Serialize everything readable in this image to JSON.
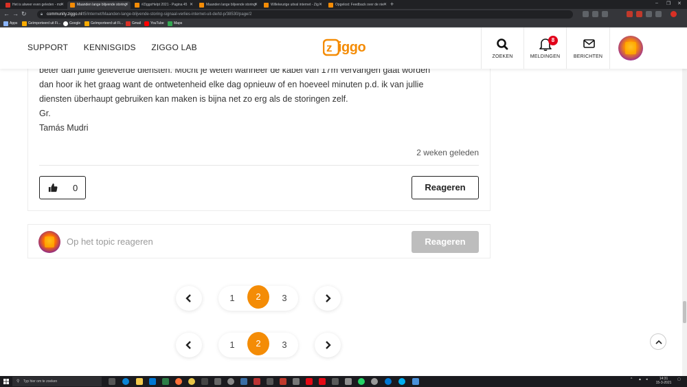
{
  "browser": {
    "tabs": [
      {
        "title": "Het is alweer even geleden - mo",
        "icon": "gmail-icon",
        "active": false
      },
      {
        "title": "Maanden lange blijvende storing",
        "icon": "ziggo-icon",
        "active": true
      },
      {
        "title": "#ZiggoHelpt 2021 - Pagina 45",
        "icon": "ziggo-icon",
        "active": false
      },
      {
        "title": "Maanden lange blijvende storing",
        "icon": "ziggo-icon",
        "active": false
      },
      {
        "title": "Willekeurige uitval internet - Zig",
        "icon": "ziggo-icon",
        "active": false
      },
      {
        "title": "Opgelost: Feedback over de nie",
        "icon": "ziggo-icon",
        "active": false
      }
    ],
    "url_host": "community.ziggo.nl",
    "url_path": "/t5/Internet/Maanden-lange-blijvende-storing-signaal-verlies-internet-uit-de/td-p/38530/page/2",
    "bookmarks": [
      {
        "label": "Apps",
        "icon": "apps-icon"
      },
      {
        "label": "Geïmporteerd uit Fi...",
        "icon": "folder-icon"
      },
      {
        "label": "Google",
        "icon": "google-icon"
      },
      {
        "label": "Geïmporteerd uit Fi...",
        "icon": "folder-icon"
      },
      {
        "label": "Gmail",
        "icon": "gmail-icon"
      },
      {
        "label": "YouTube",
        "icon": "youtube-icon"
      },
      {
        "label": "Maps",
        "icon": "maps-icon"
      }
    ]
  },
  "header": {
    "nav": [
      "SUPPORT",
      "KENNISGIDS",
      "ZIGGO LAB"
    ],
    "logo_text": "ziggo",
    "brand_color": "#f48c06",
    "search_label": "ZOEKEN",
    "notifications_label": "MELDINGEN",
    "notifications_count": "8",
    "messages_label": "BERICHTEN"
  },
  "post": {
    "lines": [
      "beter dan jullie geleverde diensten. Mocht je weten wanneer de kabel van 17m vervangen gaat worden",
      "dan hoor ik het graag want de ontwetenheid elke dag opnieuw of en hoeveel minuten p.d. ik van jullie",
      "diensten überhaupt gebruiken kan maken is bijna net zo erg als de storingen zelf.",
      "Gr.",
      "Tamás Mudri"
    ],
    "timestamp": "2 weken geleden",
    "likes": "0",
    "reply_label": "Reageren"
  },
  "reply_box": {
    "placeholder": "Op het topic reageren",
    "button_label": "Reageren"
  },
  "pagination": {
    "pages": [
      "1",
      "2",
      "3"
    ],
    "current": "2"
  },
  "taskbar": {
    "search_placeholder": "Typ hier om te zoeken",
    "time": "14:31",
    "date": "15-3-2021"
  }
}
